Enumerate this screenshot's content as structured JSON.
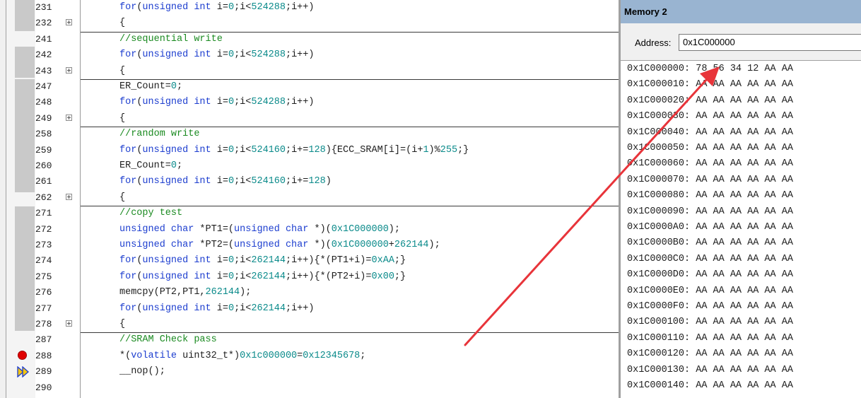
{
  "editor": {
    "lines": [
      {
        "n": "231",
        "fold": false,
        "tokens": [
          {
            "t": "for",
            "c": "kw"
          },
          {
            "t": "(",
            "c": ""
          },
          {
            "t": "unsigned int",
            "c": "kw"
          },
          {
            "t": " i=",
            "c": ""
          },
          {
            "t": "0",
            "c": "num"
          },
          {
            "t": ";i<",
            "c": ""
          },
          {
            "t": "524288",
            "c": "num"
          },
          {
            "t": ";i++)",
            "c": ""
          }
        ]
      },
      {
        "n": "232",
        "fold": true,
        "tokens": [
          {
            "t": "{",
            "c": ""
          }
        ]
      },
      {
        "n": "241",
        "fold": false,
        "tokens": [
          {
            "t": "//sequential write",
            "c": "cm"
          }
        ]
      },
      {
        "n": "242",
        "fold": false,
        "tokens": [
          {
            "t": "for",
            "c": "kw"
          },
          {
            "t": "(",
            "c": ""
          },
          {
            "t": "unsigned int",
            "c": "kw"
          },
          {
            "t": " i=",
            "c": ""
          },
          {
            "t": "0",
            "c": "num"
          },
          {
            "t": ";i<",
            "c": ""
          },
          {
            "t": "524288",
            "c": "num"
          },
          {
            "t": ";i++)",
            "c": ""
          }
        ]
      },
      {
        "n": "243",
        "fold": true,
        "tokens": [
          {
            "t": "{",
            "c": ""
          }
        ]
      },
      {
        "n": "247",
        "fold": false,
        "tokens": [
          {
            "t": "ER_Count=",
            "c": ""
          },
          {
            "t": "0",
            "c": "num"
          },
          {
            "t": ";",
            "c": ""
          }
        ]
      },
      {
        "n": "248",
        "fold": false,
        "tokens": [
          {
            "t": "for",
            "c": "kw"
          },
          {
            "t": "(",
            "c": ""
          },
          {
            "t": "unsigned int",
            "c": "kw"
          },
          {
            "t": " i=",
            "c": ""
          },
          {
            "t": "0",
            "c": "num"
          },
          {
            "t": ";i<",
            "c": ""
          },
          {
            "t": "524288",
            "c": "num"
          },
          {
            "t": ";i++)",
            "c": ""
          }
        ]
      },
      {
        "n": "249",
        "fold": true,
        "tokens": [
          {
            "t": "{",
            "c": ""
          }
        ]
      },
      {
        "n": "258",
        "fold": false,
        "tokens": [
          {
            "t": "//random write",
            "c": "cm"
          }
        ]
      },
      {
        "n": "259",
        "fold": false,
        "tokens": [
          {
            "t": "for",
            "c": "kw"
          },
          {
            "t": "(",
            "c": ""
          },
          {
            "t": "unsigned int",
            "c": "kw"
          },
          {
            "t": " i=",
            "c": ""
          },
          {
            "t": "0",
            "c": "num"
          },
          {
            "t": ";i<",
            "c": ""
          },
          {
            "t": "524160",
            "c": "num"
          },
          {
            "t": ";i+=",
            "c": ""
          },
          {
            "t": "128",
            "c": "num"
          },
          {
            "t": "){ECC_SRAM[i]=(i+",
            "c": ""
          },
          {
            "t": "1",
            "c": "num"
          },
          {
            "t": ")%",
            "c": ""
          },
          {
            "t": "255",
            "c": "num"
          },
          {
            "t": ";}",
            "c": ""
          }
        ]
      },
      {
        "n": "260",
        "fold": false,
        "tokens": [
          {
            "t": "ER_Count=",
            "c": ""
          },
          {
            "t": "0",
            "c": "num"
          },
          {
            "t": ";",
            "c": ""
          }
        ]
      },
      {
        "n": "261",
        "fold": false,
        "tokens": [
          {
            "t": "for",
            "c": "kw"
          },
          {
            "t": "(",
            "c": ""
          },
          {
            "t": "unsigned int",
            "c": "kw"
          },
          {
            "t": " i=",
            "c": ""
          },
          {
            "t": "0",
            "c": "num"
          },
          {
            "t": ";i<",
            "c": ""
          },
          {
            "t": "524160",
            "c": "num"
          },
          {
            "t": ";i+=",
            "c": ""
          },
          {
            "t": "128",
            "c": "num"
          },
          {
            "t": ")",
            "c": ""
          }
        ]
      },
      {
        "n": "262",
        "fold": true,
        "tokens": [
          {
            "t": "{",
            "c": ""
          }
        ]
      },
      {
        "n": "271",
        "fold": false,
        "tokens": [
          {
            "t": "//copy test",
            "c": "cm"
          }
        ]
      },
      {
        "n": "272",
        "fold": false,
        "tokens": [
          {
            "t": "unsigned char",
            "c": "kw"
          },
          {
            "t": " *PT1=(",
            "c": ""
          },
          {
            "t": "unsigned char",
            "c": "kw"
          },
          {
            "t": " *)(",
            "c": ""
          },
          {
            "t": "0x1C000000",
            "c": "num"
          },
          {
            "t": ");",
            "c": ""
          }
        ]
      },
      {
        "n": "273",
        "fold": false,
        "tokens": [
          {
            "t": "unsigned char",
            "c": "kw"
          },
          {
            "t": " *PT2=(",
            "c": ""
          },
          {
            "t": "unsigned char",
            "c": "kw"
          },
          {
            "t": " *)(",
            "c": ""
          },
          {
            "t": "0x1C000000",
            "c": "num"
          },
          {
            "t": "+",
            "c": ""
          },
          {
            "t": "262144",
            "c": "num"
          },
          {
            "t": ");",
            "c": ""
          }
        ]
      },
      {
        "n": "274",
        "fold": false,
        "tokens": [
          {
            "t": "for",
            "c": "kw"
          },
          {
            "t": "(",
            "c": ""
          },
          {
            "t": "unsigned int",
            "c": "kw"
          },
          {
            "t": " i=",
            "c": ""
          },
          {
            "t": "0",
            "c": "num"
          },
          {
            "t": ";i<",
            "c": ""
          },
          {
            "t": "262144",
            "c": "num"
          },
          {
            "t": ";i++){*(PT1+i)=",
            "c": ""
          },
          {
            "t": "0xAA",
            "c": "num"
          },
          {
            "t": ";}",
            "c": ""
          }
        ]
      },
      {
        "n": "275",
        "fold": false,
        "tokens": [
          {
            "t": "for",
            "c": "kw"
          },
          {
            "t": "(",
            "c": ""
          },
          {
            "t": "unsigned int",
            "c": "kw"
          },
          {
            "t": " i=",
            "c": ""
          },
          {
            "t": "0",
            "c": "num"
          },
          {
            "t": ";i<",
            "c": ""
          },
          {
            "t": "262144",
            "c": "num"
          },
          {
            "t": ";i++){*(PT2+i)=",
            "c": ""
          },
          {
            "t": "0x00",
            "c": "num"
          },
          {
            "t": ";}",
            "c": ""
          }
        ]
      },
      {
        "n": "276",
        "fold": false,
        "tokens": [
          {
            "t": "memcpy(PT2,PT1,",
            "c": ""
          },
          {
            "t": "262144",
            "c": "num"
          },
          {
            "t": ");",
            "c": ""
          }
        ]
      },
      {
        "n": "277",
        "fold": false,
        "tokens": [
          {
            "t": "for",
            "c": "kw"
          },
          {
            "t": "(",
            "c": ""
          },
          {
            "t": "unsigned int",
            "c": "kw"
          },
          {
            "t": " i=",
            "c": ""
          },
          {
            "t": "0",
            "c": "num"
          },
          {
            "t": ";i<",
            "c": ""
          },
          {
            "t": "262144",
            "c": "num"
          },
          {
            "t": ";i++)",
            "c": ""
          }
        ]
      },
      {
        "n": "278",
        "fold": true,
        "tokens": [
          {
            "t": "{",
            "c": ""
          }
        ]
      },
      {
        "n": "287",
        "fold": false,
        "tokens": [
          {
            "t": "//SRAM Check pass",
            "c": "cm"
          }
        ]
      },
      {
        "n": "288",
        "fold": false,
        "tokens": [
          {
            "t": "*(",
            "c": ""
          },
          {
            "t": "volatile",
            "c": "kw"
          },
          {
            "t": " uint32_t*)",
            "c": ""
          },
          {
            "t": "0x1c000000",
            "c": "num"
          },
          {
            "t": "=",
            "c": ""
          },
          {
            "t": "0x12345678",
            "c": "num"
          },
          {
            "t": ";",
            "c": ""
          }
        ]
      },
      {
        "n": "289",
        "fold": false,
        "tokens": [
          {
            "t": "__nop();",
            "c": ""
          }
        ]
      },
      {
        "n": "290",
        "fold": false,
        "tokens": []
      }
    ]
  },
  "memory": {
    "title": "Memory 2",
    "address_label": "Address:",
    "address_value": "0x1C000000",
    "rows": [
      "0x1C000000: 78 56 34 12 AA AA",
      "0x1C000010: AA AA AA AA AA AA",
      "0x1C000020: AA AA AA AA AA AA",
      "0x1C000030: AA AA AA AA AA AA",
      "0x1C000040: AA AA AA AA AA AA",
      "0x1C000050: AA AA AA AA AA AA",
      "0x1C000060: AA AA AA AA AA AA",
      "0x1C000070: AA AA AA AA AA AA",
      "0x1C000080: AA AA AA AA AA AA",
      "0x1C000090: AA AA AA AA AA AA",
      "0x1C0000A0: AA AA AA AA AA AA",
      "0x1C0000B0: AA AA AA AA AA AA",
      "0x1C0000C0: AA AA AA AA AA AA",
      "0x1C0000D0: AA AA AA AA AA AA",
      "0x1C0000E0: AA AA AA AA AA AA",
      "0x1C0000F0: AA AA AA AA AA AA",
      "0x1C000100: AA AA AA AA AA AA",
      "0x1C000110: AA AA AA AA AA AA",
      "0x1C000120: AA AA AA AA AA AA",
      "0x1C000130: AA AA AA AA AA AA",
      "0x1C000140: AA AA AA AA AA AA"
    ]
  },
  "colors": {
    "keyword": "#1d3ecf",
    "comment": "#1a8a20",
    "number": "#0a8a8a",
    "arrow": "#e8343a",
    "breakpoint": "#e00000",
    "title_bar": "#99b4d1"
  },
  "markers": {
    "breakpoint_icon": "breakpoint-icon",
    "current_line_icon": "current-execution-arrow-icon"
  }
}
